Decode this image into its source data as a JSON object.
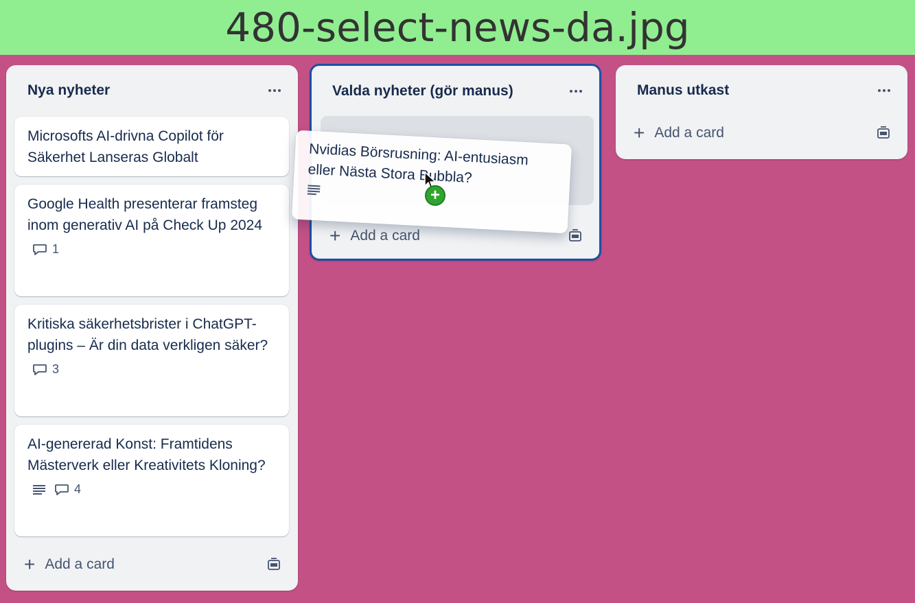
{
  "banner": {
    "title": "480-select-news-da.jpg"
  },
  "lists": [
    {
      "title": "Nya nyheter",
      "cards": [
        {
          "title": "Microsofts AI-drivna Copilot för Säkerhet Lanseras Globalt"
        },
        {
          "title": "Google Health presenterar framsteg inom generativ AI på Check Up 2024",
          "comments": "1"
        },
        {
          "title": "Kritiska säkerhetsbrister i ChatGPT-plugins – Är din data verkligen säker?",
          "comments": "3"
        },
        {
          "title": "AI-genererad Konst: Framtidens Mästerverk eller Kreativitets Kloning?",
          "has_description": true,
          "comments": "4"
        }
      ],
      "add_card_label": "Add a card"
    },
    {
      "title": "Valda nyheter (gör manus)",
      "add_card_label": "Add a card"
    },
    {
      "title": "Manus utkast",
      "add_card_label": "Add a card"
    }
  ],
  "dragging_card": {
    "title": "Nvidias Börsrusning: AI-entusiasm eller Nästa Stora Bubbla?",
    "has_description": true
  },
  "colors": {
    "board_bg": "#c45186",
    "banner_bg": "#90ee90",
    "drop_target_border": "#1d4fa5",
    "copy_badge": "#2fa52f"
  }
}
